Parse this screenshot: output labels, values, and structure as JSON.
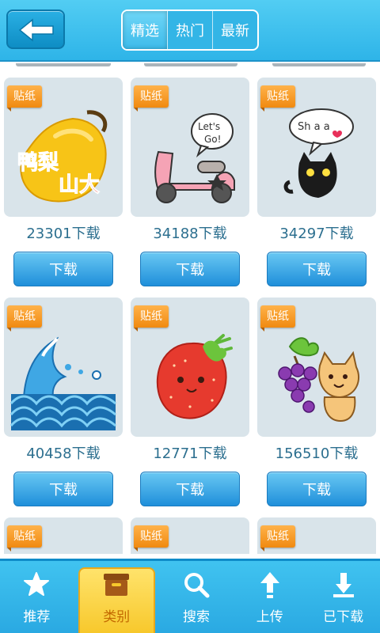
{
  "header": {
    "tabs": [
      "精选",
      "热门",
      "最新"
    ],
    "active_tab": 0
  },
  "stickers": [
    {
      "badge": "贴纸",
      "icon": "pear-sticker-icon",
      "art_text": [
        "鸭梨",
        "山大"
      ],
      "count": "23301下载",
      "button": "下载"
    },
    {
      "badge": "贴纸",
      "icon": "scooter-sticker-icon",
      "art_text": [
        "Let's",
        "Go!"
      ],
      "count": "34188下载",
      "button": "下载"
    },
    {
      "badge": "贴纸",
      "icon": "black-cat-sticker-icon",
      "art_text": [
        "Sh a a"
      ],
      "count": "34297下载",
      "button": "下载"
    },
    {
      "badge": "贴纸",
      "icon": "wave-sticker-icon",
      "count": "40458下载",
      "button": "下载"
    },
    {
      "badge": "贴纸",
      "icon": "strawberry-sticker-icon",
      "count": "12771下载",
      "button": "下载"
    },
    {
      "badge": "贴纸",
      "icon": "grapes-cat-sticker-icon",
      "count": "156510下载",
      "button": "下载"
    },
    {
      "badge": "贴纸",
      "icon": "partial-sticker-icon"
    },
    {
      "badge": "贴纸",
      "icon": "partial-sticker-icon"
    },
    {
      "badge": "贴纸",
      "icon": "partial-sticker-icon"
    }
  ],
  "bottom_nav": [
    {
      "label": "推荐",
      "icon": "star-icon"
    },
    {
      "label": "类别",
      "icon": "category-box-icon",
      "active": true
    },
    {
      "label": "搜索",
      "icon": "search-icon"
    },
    {
      "label": "上传",
      "icon": "upload-icon"
    },
    {
      "label": "已下载",
      "icon": "downloaded-icon"
    }
  ],
  "colors": {
    "header": "#2eb4e8",
    "badge": "#f08a10",
    "button": "#1f8fda",
    "active_nav": "#f7c82c"
  }
}
